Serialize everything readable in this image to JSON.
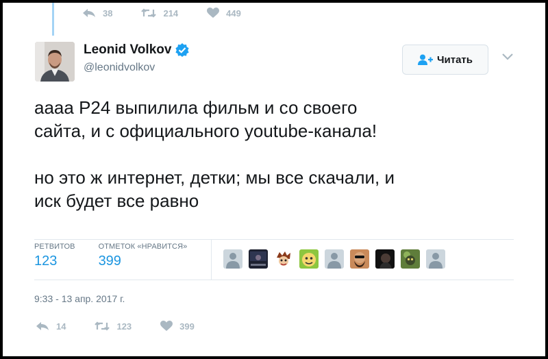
{
  "top_actions": {
    "replies": "38",
    "retweets": "214",
    "likes": "449"
  },
  "author": {
    "name": "Leonid Volkov",
    "handle": "@leonidvolkov"
  },
  "follow_label": "Читать",
  "tweet": {
    "text": "аааа Р24 выпилила фильм и со своего\nсайта, и с официального youtube-канала!\n\nно это ж интернет, детки; мы все скачали, и\nиск будет все равно"
  },
  "stats": {
    "retweets_label": "РЕТВИТОВ",
    "retweets_value": "123",
    "likes_label": "ОТМЕТОК «НРАВИТСЯ»",
    "likes_value": "399"
  },
  "likers": [
    "default-avatar",
    "photo-avatar",
    "cartoon-avatar",
    "cartoon-avatar",
    "default-avatar",
    "photo-avatar",
    "photo-avatar",
    "photo-avatar",
    "default-avatar"
  ],
  "timestamp": "9:33 - 13 апр. 2017 г.",
  "bottom_actions": {
    "replies": "14",
    "retweets": "123",
    "likes": "399"
  },
  "colors": {
    "accent": "#1b95e0",
    "muted": "#aab8c2",
    "text": "#14171a"
  }
}
